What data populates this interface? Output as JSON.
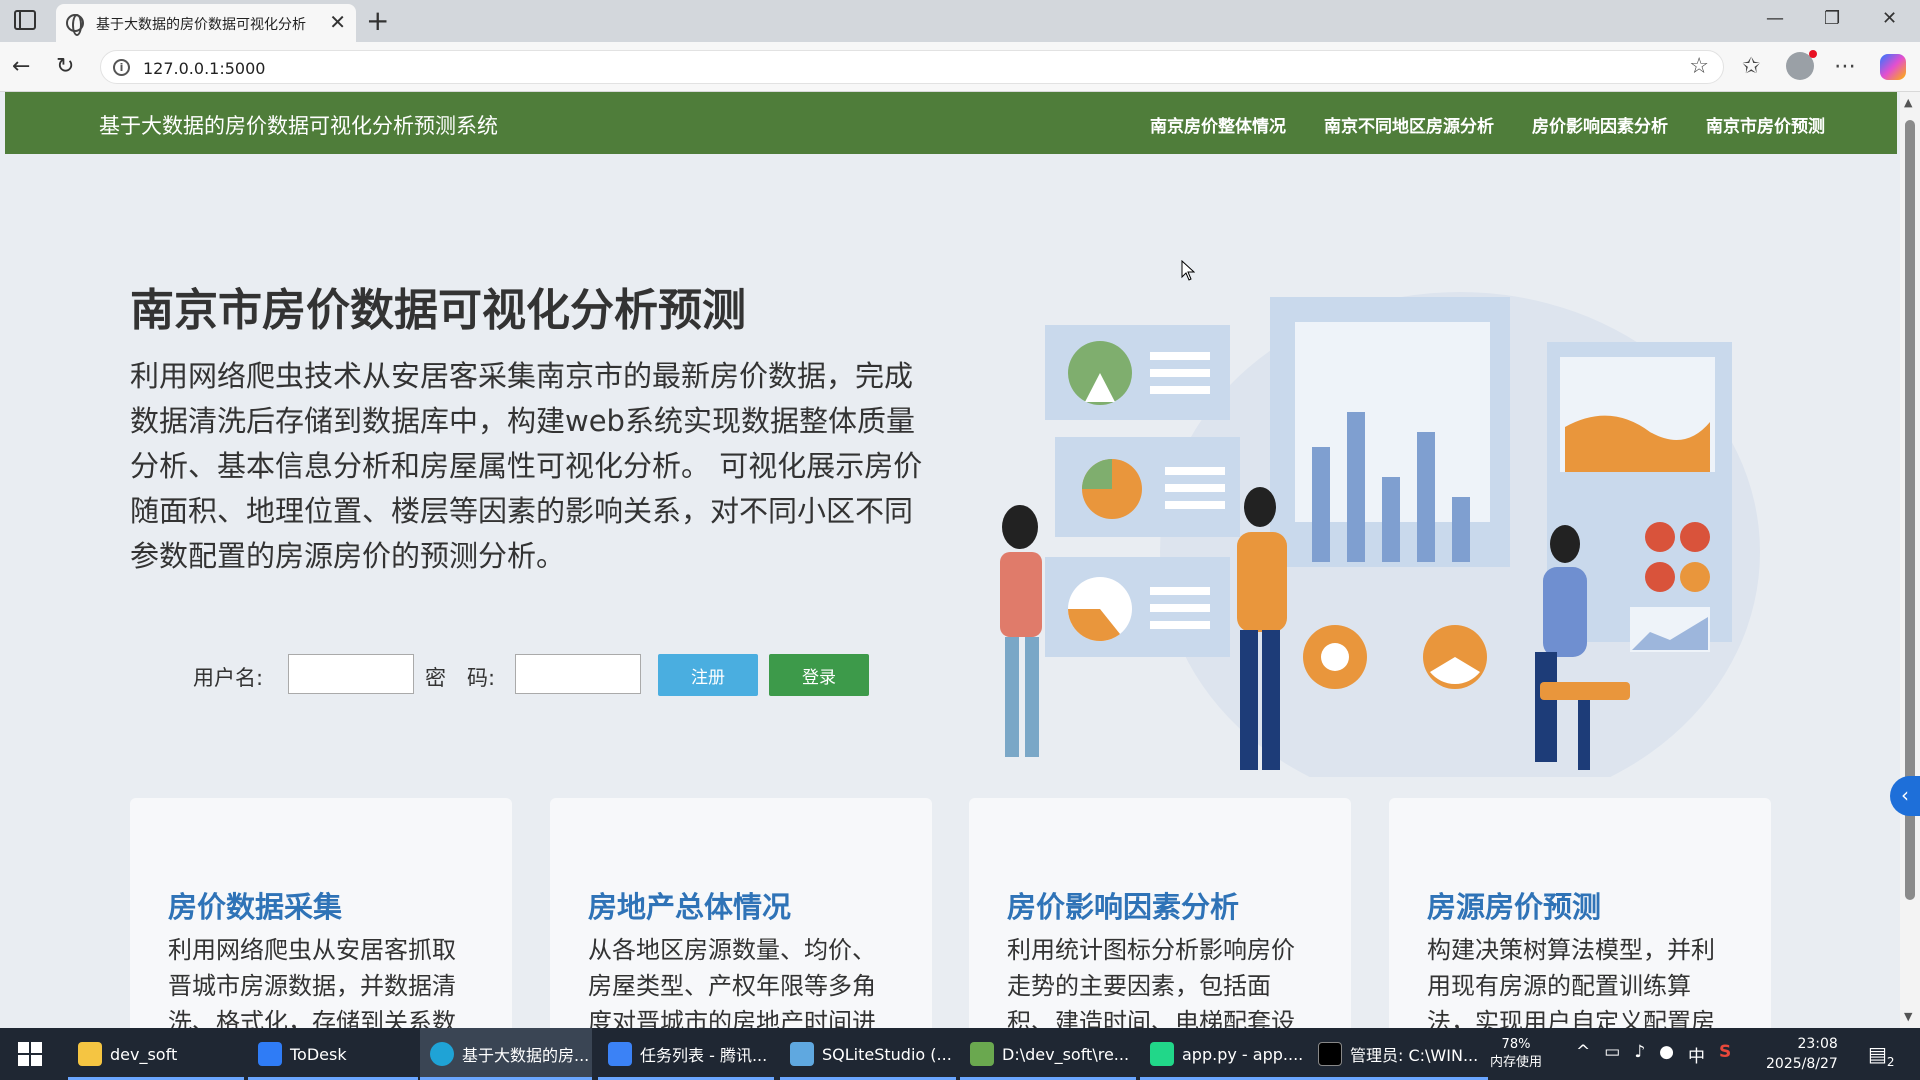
{
  "browser": {
    "tab_title": "基于大数据的房价数据可视化分析",
    "url": "127.0.0.1:5000"
  },
  "site": {
    "brand": "基于大数据的房价数据可视化分析预测系统",
    "nav": [
      "南京房价整体情况",
      "南京不同地区房源分析",
      "房价影响因素分析",
      "南京市房价预测"
    ]
  },
  "hero": {
    "title": "南京市房价数据可视化分析预测",
    "description": "利用网络爬虫技术从安居客采集南京市的最新房价数据，完成数据清洗后存储到数据库中，构建web系统实现数据整体质量分析、基本信息分析和房屋属性可视化分析。 可视化展示房价随面积、地理位置、楼层等因素的影响关系，对不同小区不同参数配置的房源房价的预测分析。"
  },
  "login": {
    "username_label": "用户名:",
    "password_label": "密　码:",
    "username_value": "",
    "password_value": "",
    "register_label": "注册",
    "login_label": "登录"
  },
  "cards": [
    {
      "title": "房价数据采集",
      "text": "利用网络爬虫从安居客抓取晋城市房源数据，并数据清洗、格式化，存储到关系数"
    },
    {
      "title": "房地产总体情况",
      "text": "从各地区房源数量、均价、房屋类型、产权年限等多角度对晋城市的房地产时间进"
    },
    {
      "title": "房价影响因素分析",
      "text": "利用统计图标分析影响房价走势的主要因素，包括面积、建造时间、电梯配套设"
    },
    {
      "title": "房源房价预测",
      "text": "构建决策树算法模型，并利用现有房源的配置训练算法，实现用户自定义配置房"
    }
  ],
  "taskbar": {
    "items": [
      "dev_soft",
      "ToDesk",
      "基于大数据的房...",
      "任务列表 - 腾讯...",
      "SQLiteStudio (...",
      "D:\\dev_soft\\re...",
      "app.py - app....",
      "管理员: C:\\WIN..."
    ],
    "memory_percent": "78%",
    "memory_label": "内存使用",
    "ime": "中",
    "time": "23:08",
    "date": "2025/8/27",
    "notification_count": "2"
  },
  "colors": {
    "header_green": "#4f7d3a",
    "card_title_blue": "#2f73b7",
    "register_blue": "#4aaee0",
    "login_green": "#3d9a4a"
  }
}
